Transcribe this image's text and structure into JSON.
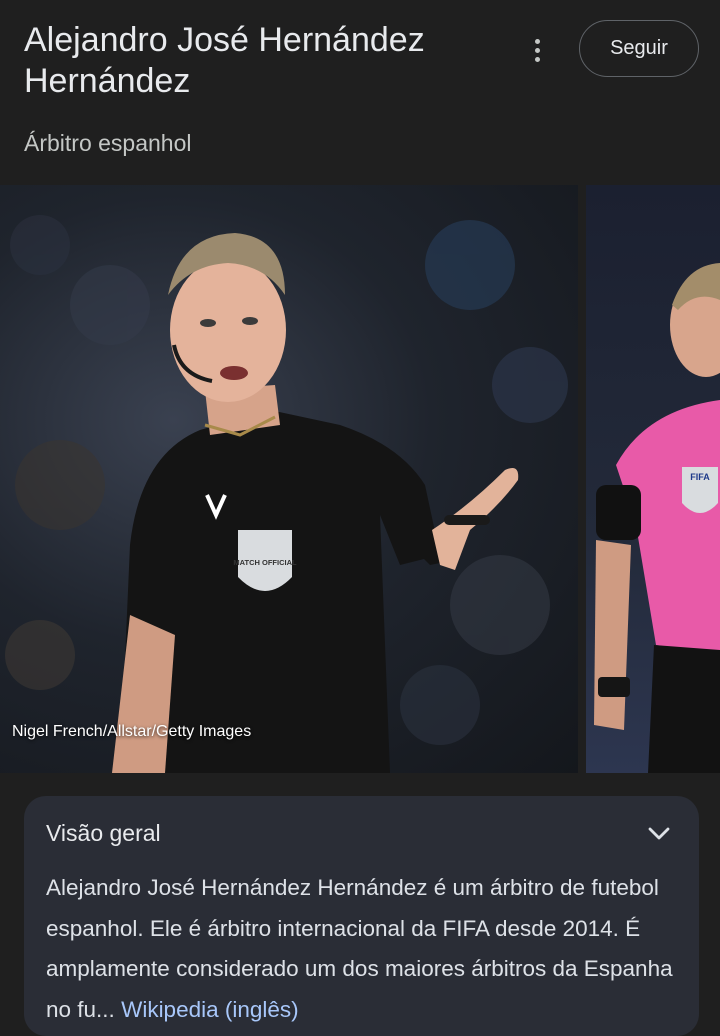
{
  "header": {
    "title": "Alejandro José Hernández Hernández",
    "subtitle": "Árbitro espanhol",
    "follow_label": "Seguir"
  },
  "gallery": {
    "caption": "Nigel French/Allstar/Getty Images",
    "badge_main": "MATCH OFFICIAL",
    "badge_side": "FIFA"
  },
  "overview": {
    "title": "Visão geral",
    "text": "Alejandro José Hernández Hernández é um árbitro de futebol espanhol. Ele é árbitro internacional da FIFA desde 2014. É amplamente considerado um dos maiores árbitros da Espanha no fu",
    "ellipsis": "...",
    "link_label": "Wikipedia (inglês)"
  },
  "icons": {
    "more": "more-vert-icon",
    "expand": "chevron-down-icon"
  },
  "colors": {
    "background": "#1f1f1f",
    "card": "#2a2d36",
    "link": "#a8c7fa",
    "kit_side": "#e85aa8"
  }
}
